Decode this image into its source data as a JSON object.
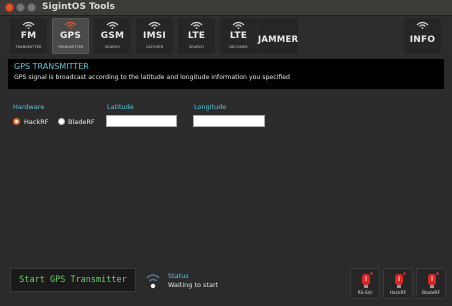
{
  "window": {
    "title": "SigintOS Tools"
  },
  "toolbar": {
    "buttons": [
      {
        "big": "FM",
        "small": "TRANSMITTER",
        "active": false
      },
      {
        "big": "GPS",
        "small": "TRANSMITTER",
        "active": true
      },
      {
        "big": "GSM",
        "small": "SEARCH",
        "active": false
      },
      {
        "big": "IMSI",
        "small": "CATCHER",
        "active": false
      },
      {
        "big": "LTE",
        "small": "SEARCH",
        "active": false
      },
      {
        "big": "LTE",
        "small": "DECODER",
        "active": false
      },
      {
        "big": "JAMMER",
        "small": "",
        "active": false
      },
      {
        "big": "INFO",
        "small": "",
        "active": false
      }
    ]
  },
  "header": {
    "title": "GPS TRANSMITTER",
    "description": "GPS signal is broadcast according to the latitude and longitude information you specified"
  },
  "form": {
    "hardware_label": "Hardware",
    "options": [
      {
        "label": "HackRF",
        "selected": true
      },
      {
        "label": "BladeRF",
        "selected": false
      }
    ],
    "latitude_label": "Latitude",
    "latitude_value": "",
    "longitude_label": "Longitude",
    "longitude_value": ""
  },
  "footer": {
    "start_label": "Start GPS Transmitter",
    "status_label": "Status",
    "status_value": "Waiting to start",
    "devices": [
      "RS-Sdr",
      "HackRF",
      "BladeRF"
    ]
  },
  "colors": {
    "accent": "#5cc7dd",
    "start_text": "#6bd36b",
    "radio_selected": "#e66b2e",
    "device_led": "#e0282c"
  }
}
